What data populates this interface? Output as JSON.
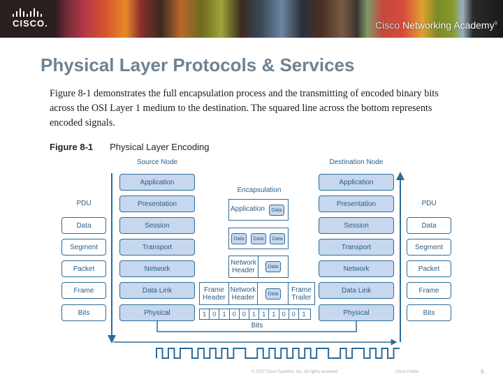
{
  "header": {
    "logo_text": "CISCO.",
    "academy_prefix": "Cisco",
    "academy_name": "Networking Academy",
    "academy_mark": "®"
  },
  "slide": {
    "title": "Physical Layer Protocols & Services",
    "paragraph": "Figure 8-1 demonstrates the full encapsulation process and the transmitting of encoded binary bits across the OSI Layer 1 medium to the destination. The squared line across the bottom represents encoded signals.",
    "figure_number": "Figure 8-1",
    "figure_title": "Physical Layer Encoding"
  },
  "diagram": {
    "source_label": "Source Node",
    "destination_label": "Destination Node",
    "pdu_label": "PDU",
    "encapsulation_label": "Encapsulation",
    "layers": [
      "Application",
      "Presentation",
      "Session",
      "Transport",
      "Network",
      "Data Link",
      "Physical"
    ],
    "pdus": [
      "Data",
      "Segment",
      "Packet",
      "Frame",
      "Bits"
    ],
    "encapsulation": {
      "application_label": "Application",
      "data_label": "Data",
      "network_header": "Network Header",
      "frame_header": "Frame Header",
      "frame_trailer": "Frame Trailer"
    },
    "bits": [
      "1",
      "0",
      "1",
      "0",
      "0",
      "1",
      "1",
      "1",
      "0",
      "0",
      "1"
    ],
    "bits_label": "Bits",
    "colors": {
      "layer_fill": "#c6d7ee",
      "line": "#2c6a99",
      "text": "#2b5d86"
    }
  },
  "footer": {
    "copyright": "© 2007 Cisco Systems, Inc. All rights reserved.",
    "classification": "Cisco Public",
    "page_number": "6"
  }
}
